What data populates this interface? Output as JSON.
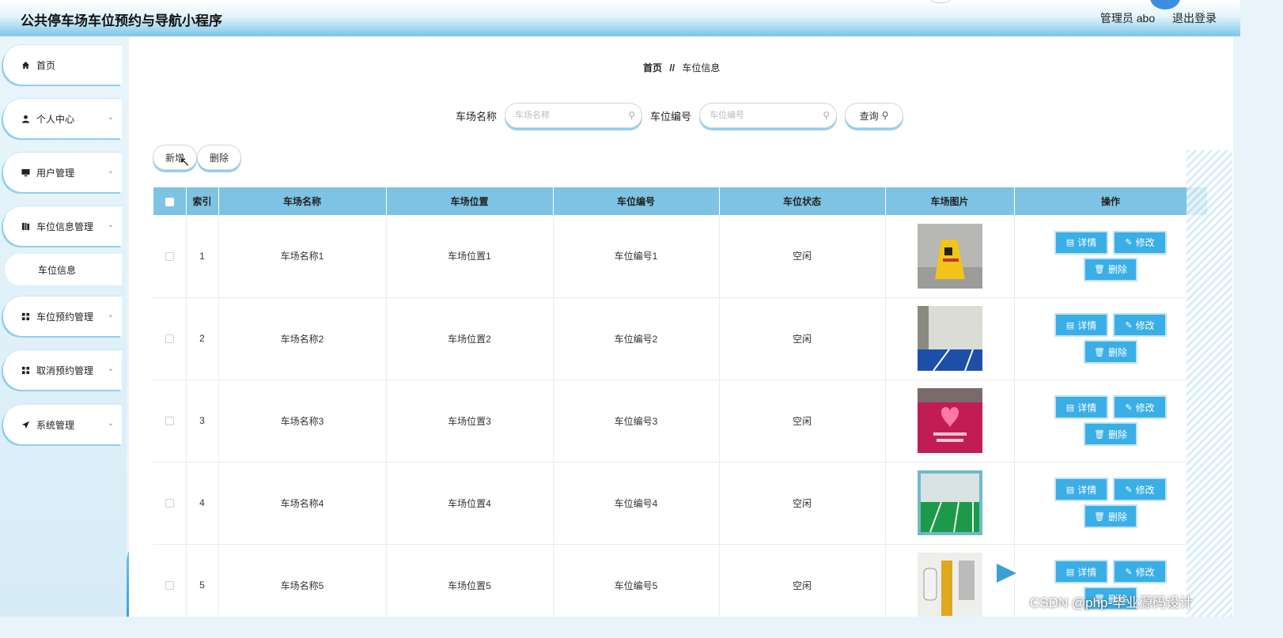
{
  "header": {
    "title": "公共停车场车位预约与导航小程序",
    "user_label": "管理员 abo",
    "logout_label": "退出登录"
  },
  "sidebar": {
    "items": [
      {
        "label": "首页",
        "icon": "home-icon"
      },
      {
        "label": "个人中心",
        "icon": "user-icon"
      },
      {
        "label": "用户管理",
        "icon": "monitor-icon"
      },
      {
        "label": "车位信息管理",
        "icon": "book-icon"
      },
      {
        "label": "车位预约管理",
        "icon": "grid-icon"
      },
      {
        "label": "取消预约管理",
        "icon": "grid-icon"
      },
      {
        "label": "系统管理",
        "icon": "send-icon"
      }
    ],
    "submenu": {
      "label": "车位信息"
    }
  },
  "breadcrumb": {
    "home": "首页",
    "separator": "//",
    "current": "车位信息"
  },
  "search": {
    "field1_label": "车场名称",
    "field1_placeholder": "车场名称",
    "field2_label": "车位编号",
    "field2_placeholder": "车位编号",
    "query_label": "查询"
  },
  "actions": {
    "add_label": "新增",
    "delete_label": "删除"
  },
  "table": {
    "headers": [
      "索引",
      "车场名称",
      "车场位置",
      "车位编号",
      "车位状态",
      "车场图片",
      "操作"
    ],
    "rows": [
      {
        "index": "1",
        "name": "车场名称1",
        "location": "车场位置1",
        "spot": "车位编号1",
        "status": "空闲"
      },
      {
        "index": "2",
        "name": "车场名称2",
        "location": "车场位置2",
        "spot": "车位编号2",
        "status": "空闲"
      },
      {
        "index": "3",
        "name": "车场名称3",
        "location": "车场位置3",
        "spot": "车位编号3",
        "status": "空闲"
      },
      {
        "index": "4",
        "name": "车场名称4",
        "location": "车场位置4",
        "spot": "车位编号4",
        "status": "空闲"
      },
      {
        "index": "5",
        "name": "车场名称5",
        "location": "车场位置5",
        "spot": "车位编号5",
        "status": "空闲"
      }
    ],
    "op_detail": "详情",
    "op_edit": "修改",
    "op_delete": "删除"
  },
  "watermark": "CSDN @php-毕业源码设计",
  "colors": {
    "accent": "#3aaee6",
    "header_row": "#7ec3e3",
    "sidebar_shadow": "#8fd0ee"
  }
}
